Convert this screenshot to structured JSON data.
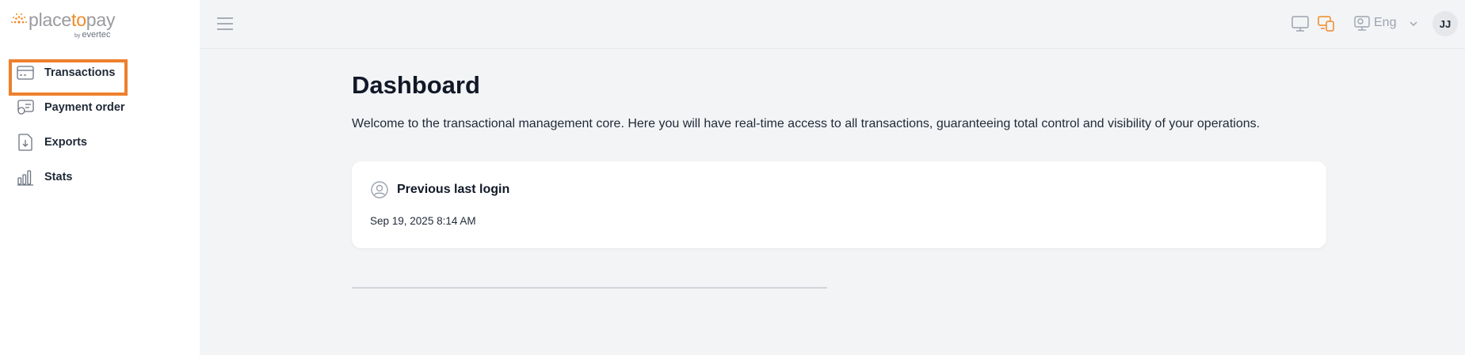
{
  "brand": {
    "name_part1": "place",
    "name_accent": "to",
    "name_part2": "pay",
    "sub_by": "by",
    "sub_name": "evertec",
    "accent_color": "#f08a24"
  },
  "sidebar": {
    "items": [
      {
        "label": "Transactions",
        "icon": "card-icon",
        "active": true
      },
      {
        "label": "Payment order",
        "icon": "payment-order-icon",
        "active": false
      },
      {
        "label": "Exports",
        "icon": "export-file-icon",
        "active": false
      },
      {
        "label": "Stats",
        "icon": "bar-chart-icon",
        "active": false
      }
    ],
    "highlight_color": "#ee7f2d"
  },
  "topbar": {
    "menu_icon": "hamburger-icon",
    "language": "Eng",
    "avatar_initials": "JJ"
  },
  "main": {
    "title": "Dashboard",
    "description": "Welcome to the transactional management core. Here you will have real-time access to all transactions, guaranteeing total control and visibility of your operations.",
    "card": {
      "title": "Previous last login",
      "value": "Sep 19, 2025 8:14 AM"
    }
  }
}
